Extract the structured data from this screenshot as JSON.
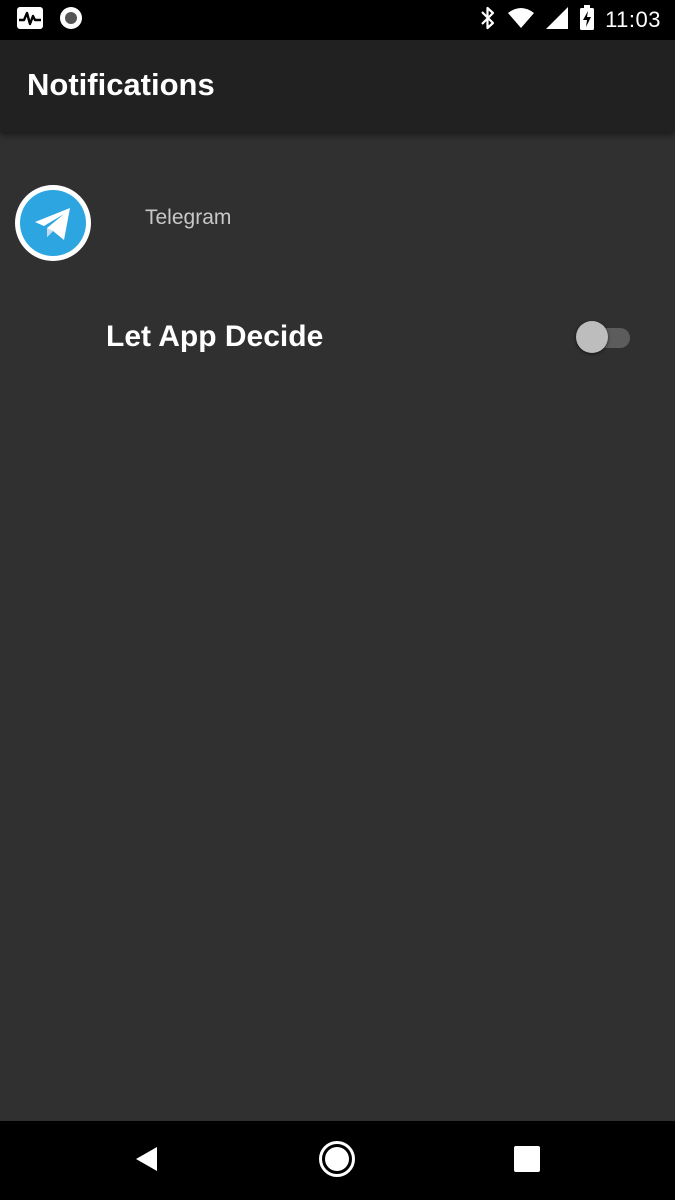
{
  "status_bar": {
    "time": "11:03",
    "left_icons": [
      "activity-monitor-icon",
      "record-icon"
    ],
    "right_icons": [
      "bluetooth-icon",
      "wifi-icon",
      "cell-signal-icon",
      "battery-charging-icon"
    ]
  },
  "app_bar": {
    "title": "Notifications"
  },
  "app": {
    "name": "Telegram",
    "icon": "telegram-icon",
    "icon_color": "#2ca5e0"
  },
  "setting": {
    "label": "Let App Decide",
    "enabled": false
  },
  "nav_bar": {
    "icons": [
      "back-icon",
      "home-icon",
      "recents-icon"
    ]
  }
}
